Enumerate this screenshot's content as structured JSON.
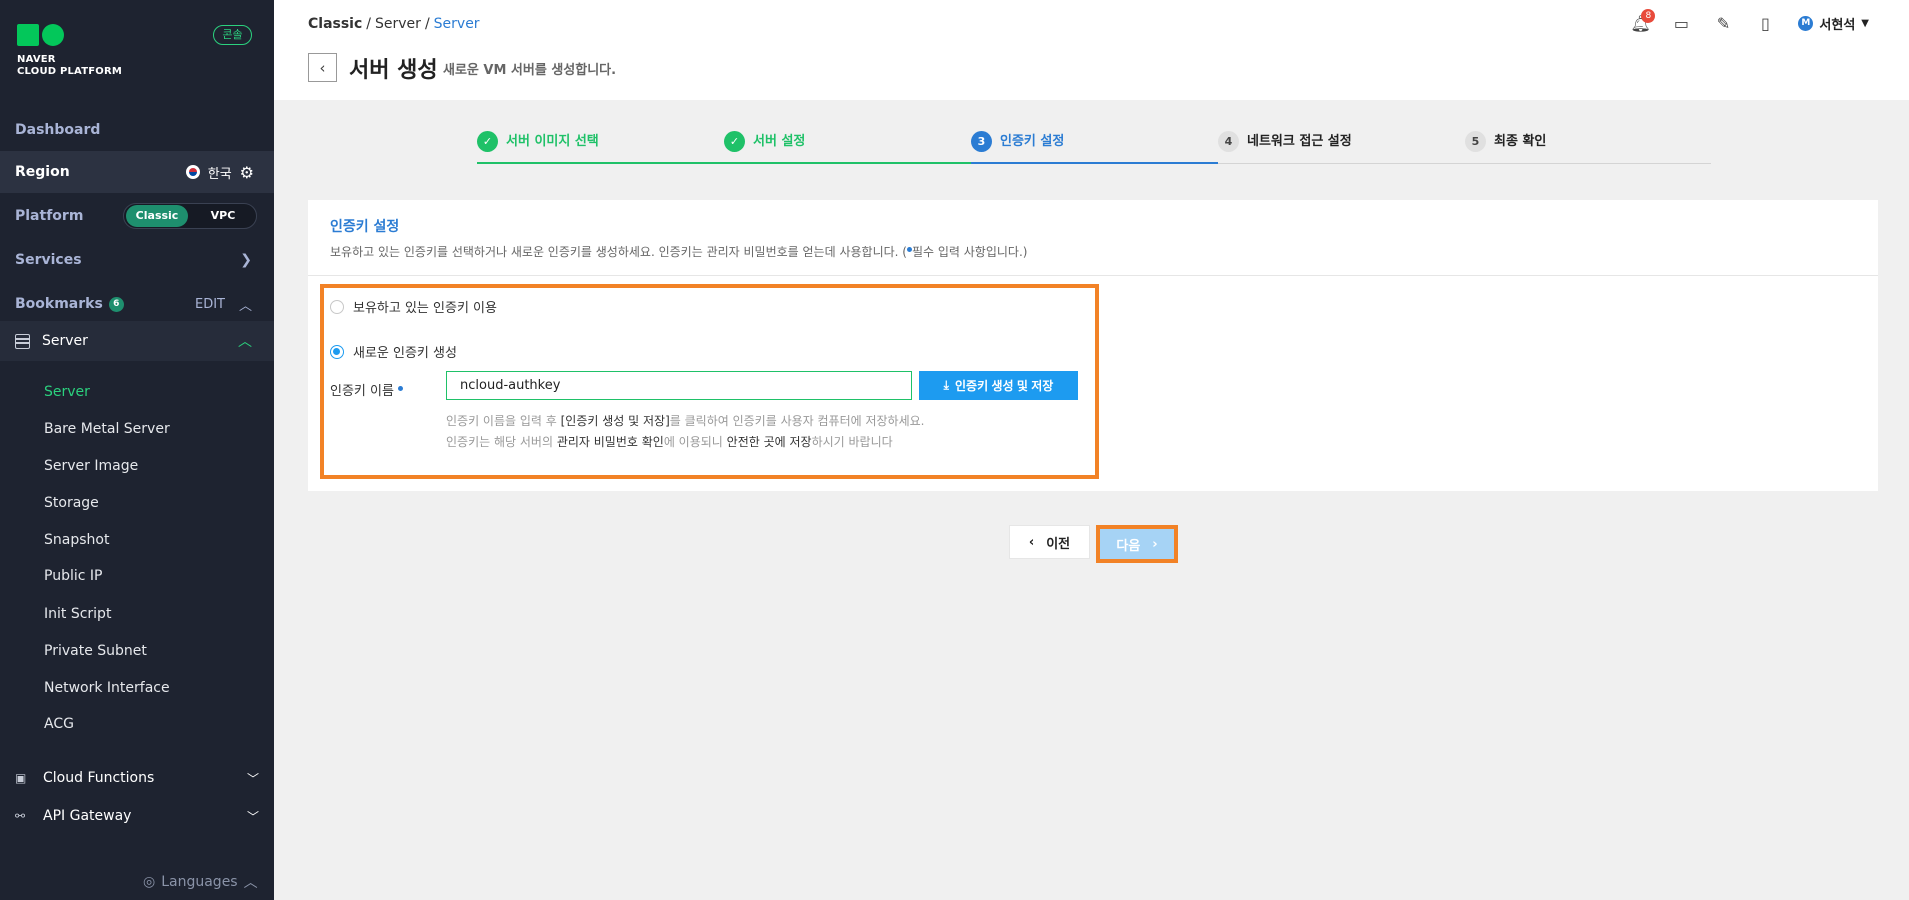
{
  "sidebar": {
    "logo_text_line1": "NAVER",
    "logo_text_line2": "CLOUD PLATFORM",
    "console_badge": "콘솔",
    "dashboard": "Dashboard",
    "region_label": "Region",
    "region_value": "한국",
    "platform_label": "Platform",
    "platform_options": [
      "Classic",
      "VPC"
    ],
    "platform_selected": "Classic",
    "services": "Services",
    "bookmarks": "Bookmarks",
    "bookmarks_count": "6",
    "bookmarks_edit": "EDIT",
    "server_group": "Server",
    "server_items": [
      "Server",
      "Bare Metal Server",
      "Server Image",
      "Storage",
      "Snapshot",
      "Public IP",
      "Init Script",
      "Private Subnet",
      "Network Interface",
      "ACG"
    ],
    "active_item": "Server",
    "sections": [
      "Cloud Functions",
      "API Gateway"
    ],
    "languages": "Languages"
  },
  "header": {
    "breadcrumb": [
      "Classic",
      "Server",
      "Server"
    ],
    "title": "서버 생성",
    "subtitle": "새로운 VM 서버를 생성합니다.",
    "notif_count": "8",
    "user_initial": "M",
    "user_name": "서현석"
  },
  "steps": [
    {
      "num": "1",
      "label": "서버 이미지 선택",
      "state": "done"
    },
    {
      "num": "2",
      "label": "서버 설정",
      "state": "done"
    },
    {
      "num": "3",
      "label": "인증키 설정",
      "state": "current"
    },
    {
      "num": "4",
      "label": "네트워크 접근 설정",
      "state": "pending"
    },
    {
      "num": "5",
      "label": "최종 확인",
      "state": "pending"
    }
  ],
  "panel": {
    "title": "인증키 설정",
    "desc_main": "보유하고 있는 인증키를 선택하거나 새로운 인증키를 생성하세요. 인증키는 관리자 비밀번호를 얻는데 사용합니다. (",
    "desc_req": "필수 입력 사항입니다.)",
    "option_existing": "보유하고 있는 인증키 이용",
    "option_new": "새로운 인증키 생성",
    "selected_option": "new",
    "field_label": "인증키 이름",
    "key_value": "ncloud-authkey",
    "gen_button": "인증키 생성 및 저장",
    "help1_a": "인증키 이름을 입력 후 ",
    "help1_b": "[인증키 생성 및 저장]",
    "help1_c": "를 클릭하여 인증키를 사용자 컴퓨터에 저장하세요.",
    "help2_a": "인증키는 해당 서버의 ",
    "help2_b": "관리자 비밀번호 확인",
    "help2_c": "에 이용되니 ",
    "help2_d": "안전한 곳에 저장",
    "help2_e": "하시기 바랍니다"
  },
  "nav": {
    "prev": "이전",
    "next": "다음"
  },
  "colors": {
    "brand_green": "#03c75a",
    "step_done": "#1fc168",
    "step_current": "#2b7cd3",
    "primary_button": "#1d9bf0",
    "highlight": "#f28226"
  }
}
